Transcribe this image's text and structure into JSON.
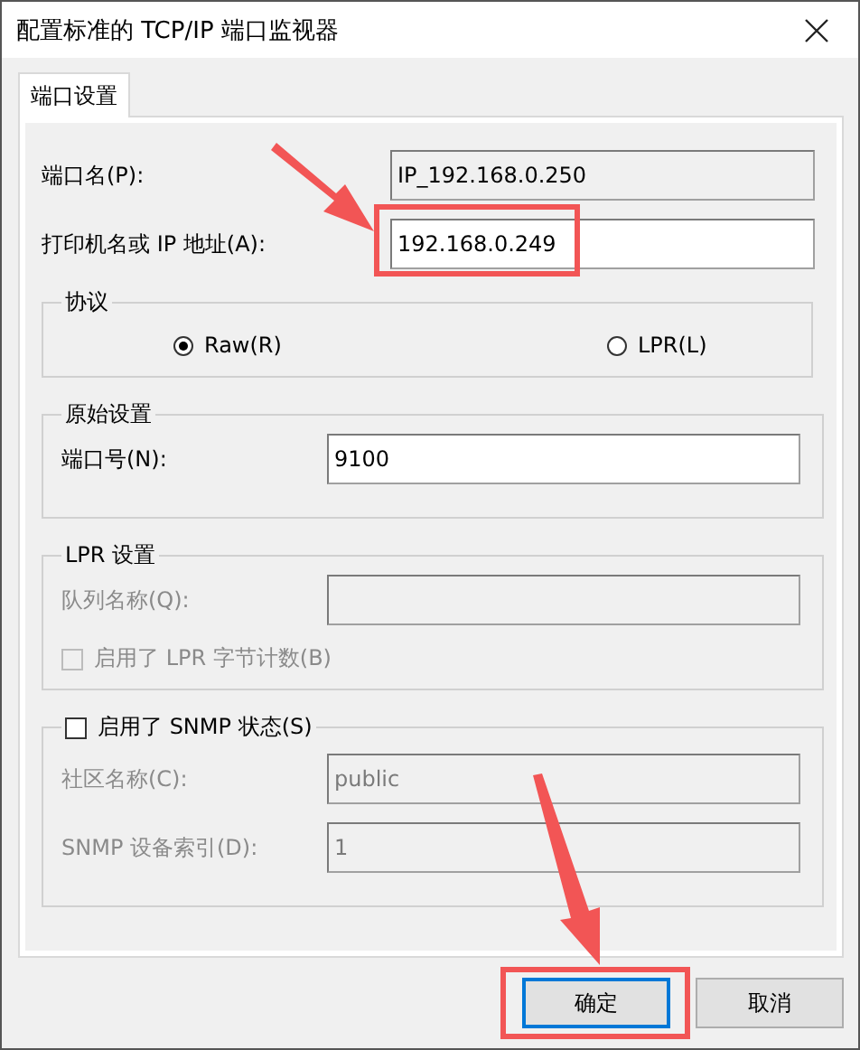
{
  "window": {
    "title": "配置标准的 TCP/IP 端口监视器"
  },
  "tabs": [
    {
      "label": "端口设置",
      "selected": true
    }
  ],
  "port_fields": [
    {
      "label": "端口名(P):",
      "value": "IP_192.168.0.250",
      "readonly": true,
      "highlighted": false
    },
    {
      "label": "打印机名或 IP 地址(A):",
      "value": "192.168.0.249",
      "readonly": false,
      "highlighted": true
    }
  ],
  "protocol": {
    "legend": "协议",
    "options": [
      {
        "label": "Raw(R)",
        "selected": true
      },
      {
        "label": "LPR(L)",
        "selected": false
      }
    ]
  },
  "raw_settings": {
    "legend": "原始设置",
    "fields": [
      {
        "label": "端口号(N):",
        "value": "9100",
        "disabled": false
      }
    ]
  },
  "lpr_settings": {
    "legend": "LPR 设置",
    "fields": [
      {
        "label": "队列名称(Q):",
        "disabled": true
      }
    ],
    "byte_count": {
      "label": "启用了 LPR 字节计数(B)",
      "checked": false,
      "disabled": true
    }
  },
  "snmp": {
    "label": "启用了 SNMP 状态(S)",
    "checked": false,
    "fields": [
      {
        "label": "社区名称(C):",
        "value": "public",
        "disabled": true
      },
      {
        "label": "SNMP 设备索引(D):",
        "value": "1",
        "disabled": true
      }
    ]
  },
  "buttons": [
    {
      "label": "确定",
      "default": true,
      "highlighted": true
    },
    {
      "label": "取消",
      "default": false,
      "highlighted": false
    }
  ]
}
